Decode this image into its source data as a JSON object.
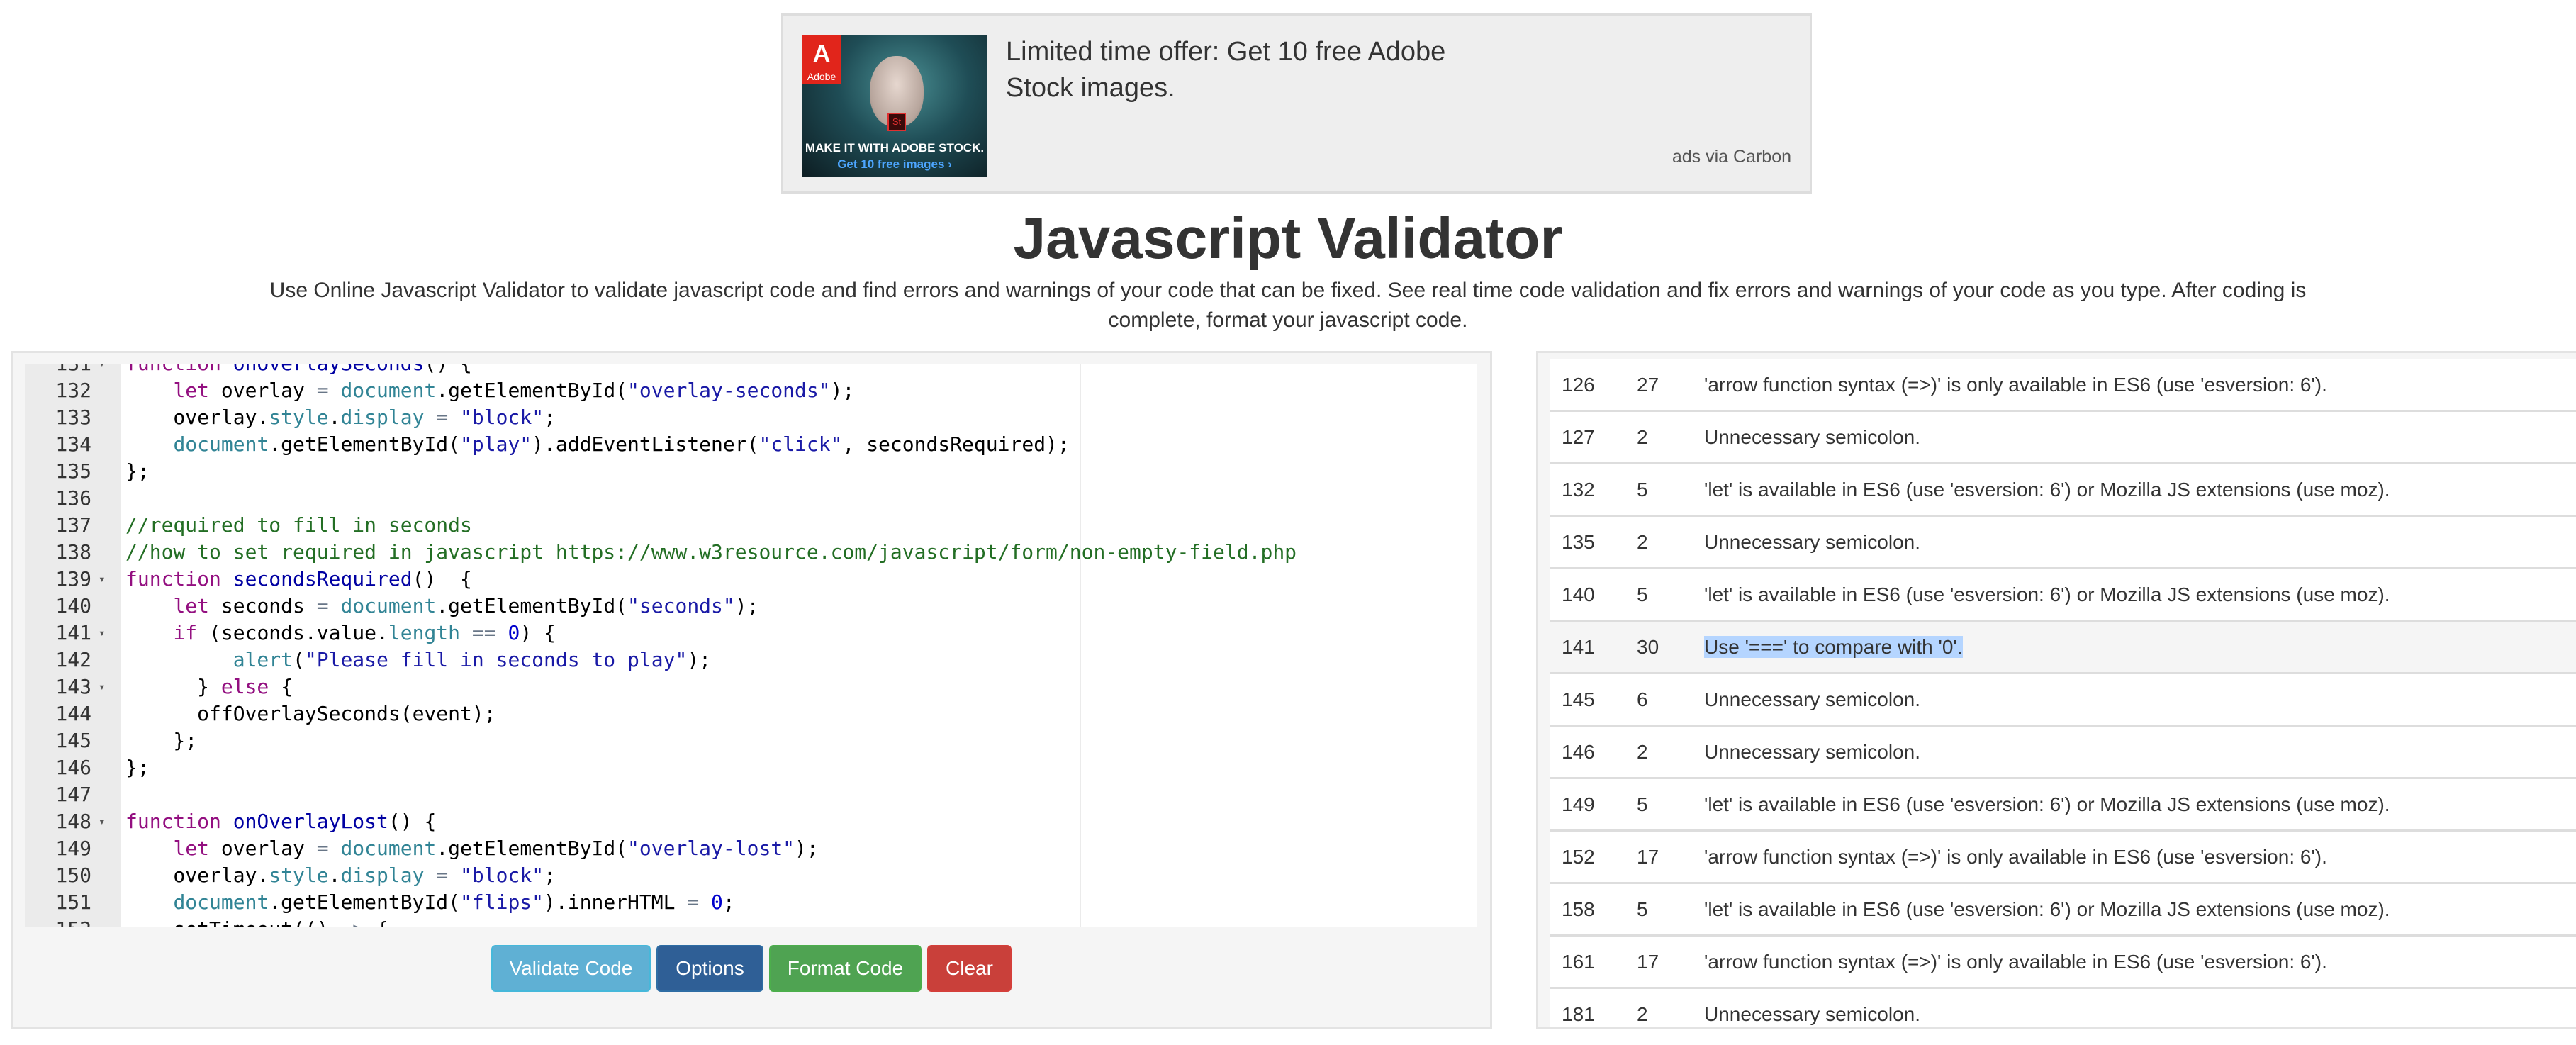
{
  "ad": {
    "logo_text": "Adobe",
    "image_line1": "MAKE IT WITH ADOBE STOCK.",
    "image_line2": "Get 10 free images ›",
    "stock_badge": "St",
    "headline": "Limited time offer: Get 10 free Adobe Stock images.",
    "via": "ads via Carbon"
  },
  "page": {
    "title": "Javascript Validator",
    "description": "Use Online Javascript Validator to validate javascript code and find errors and warnings of your code that can be fixed. See real time code validation and fix errors and warnings of your code as you type. After coding is complete, format your javascript code."
  },
  "editor": {
    "lines": [
      {
        "n": "131",
        "fold": true,
        "text": "function onOverlaySeconds() {"
      },
      {
        "n": "132",
        "fold": false,
        "text": "    let overlay = document.getElementById(\"overlay-seconds\");"
      },
      {
        "n": "133",
        "fold": false,
        "text": "    overlay.style.display = \"block\";"
      },
      {
        "n": "134",
        "fold": false,
        "text": "    document.getElementById(\"play\").addEventListener(\"click\", secondsRequired);"
      },
      {
        "n": "135",
        "fold": false,
        "text": "};"
      },
      {
        "n": "136",
        "fold": false,
        "text": ""
      },
      {
        "n": "137",
        "fold": false,
        "text": "//required to fill in seconds"
      },
      {
        "n": "138",
        "fold": false,
        "text": "//how to set required in javascript https://www.w3resource.com/javascript/form/non-empty-field.php"
      },
      {
        "n": "139",
        "fold": true,
        "text": "function secondsRequired()  {"
      },
      {
        "n": "140",
        "fold": false,
        "text": "    let seconds = document.getElementById(\"seconds\");"
      },
      {
        "n": "141",
        "fold": true,
        "text": "    if (seconds.value.length == 0) {"
      },
      {
        "n": "142",
        "fold": false,
        "text": "         alert(\"Please fill in seconds to play\");"
      },
      {
        "n": "143",
        "fold": true,
        "text": "      } else {"
      },
      {
        "n": "144",
        "fold": false,
        "text": "      offOverlaySeconds(event);"
      },
      {
        "n": "145",
        "fold": false,
        "text": "    };"
      },
      {
        "n": "146",
        "fold": false,
        "text": "};"
      },
      {
        "n": "147",
        "fold": false,
        "text": ""
      },
      {
        "n": "148",
        "fold": true,
        "text": "function onOverlayLost() {"
      },
      {
        "n": "149",
        "fold": false,
        "text": "    let overlay = document.getElementById(\"overlay-lost\");"
      },
      {
        "n": "150",
        "fold": false,
        "text": "    overlay.style.display = \"block\";"
      },
      {
        "n": "151",
        "fold": false,
        "text": "    document.getElementById(\"flips\").innerHTML = 0;"
      },
      {
        "n": "152",
        "fold": true,
        "text": "    setTimeout(() => {"
      }
    ]
  },
  "buttons": {
    "validate": "Validate Code",
    "options": "Options",
    "format": "Format Code",
    "clear": "Clear"
  },
  "results": {
    "highlighted_row": 5,
    "rows": [
      {
        "line": "126",
        "col": "27",
        "message": "'arrow function syntax (=>)' is only available in ES6 (use 'esversion: 6')."
      },
      {
        "line": "127",
        "col": "2",
        "message": "Unnecessary semicolon."
      },
      {
        "line": "132",
        "col": "5",
        "message": "'let' is available in ES6 (use 'esversion: 6') or Mozilla JS extensions (use moz)."
      },
      {
        "line": "135",
        "col": "2",
        "message": "Unnecessary semicolon."
      },
      {
        "line": "140",
        "col": "5",
        "message": "'let' is available in ES6 (use 'esversion: 6') or Mozilla JS extensions (use moz)."
      },
      {
        "line": "141",
        "col": "30",
        "message": "Use '===' to compare with '0'."
      },
      {
        "line": "145",
        "col": "6",
        "message": "Unnecessary semicolon."
      },
      {
        "line": "146",
        "col": "2",
        "message": "Unnecessary semicolon."
      },
      {
        "line": "149",
        "col": "5",
        "message": "'let' is available in ES6 (use 'esversion: 6') or Mozilla JS extensions (use moz)."
      },
      {
        "line": "152",
        "col": "17",
        "message": "'arrow function syntax (=>)' is only available in ES6 (use 'esversion: 6')."
      },
      {
        "line": "158",
        "col": "5",
        "message": "'let' is available in ES6 (use 'esversion: 6') or Mozilla JS extensions (use moz)."
      },
      {
        "line": "161",
        "col": "17",
        "message": "'arrow function syntax (=>)' is only available in ES6 (use 'esversion: 6')."
      },
      {
        "line": "181",
        "col": "2",
        "message": "Unnecessary semicolon."
      }
    ]
  }
}
